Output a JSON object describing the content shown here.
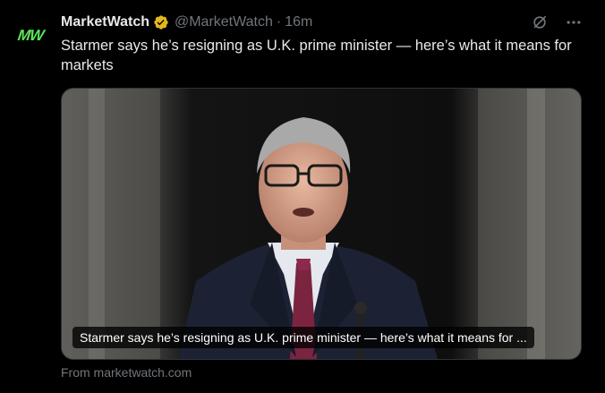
{
  "tweet": {
    "avatar_text": "MW",
    "author_name": "MarketWatch",
    "handle": "@MarketWatch",
    "separator": "·",
    "time": "16m",
    "text": "Starmer says he’s resigning as U.K. prime minister — here’s what it means for markets",
    "card": {
      "caption": "Starmer says he’s resigning as U.K. prime minister — here’s what it means for ...",
      "source": "From marketwatch.com"
    },
    "icons": [
      "verified-badge-icon",
      "grok-icon",
      "more-icon"
    ]
  },
  "colors": {
    "background": "#000000",
    "text": "#e7e9ea",
    "muted": "#71767b",
    "verified_gold": "#e2b719",
    "logo_green": "#5ee65a"
  }
}
